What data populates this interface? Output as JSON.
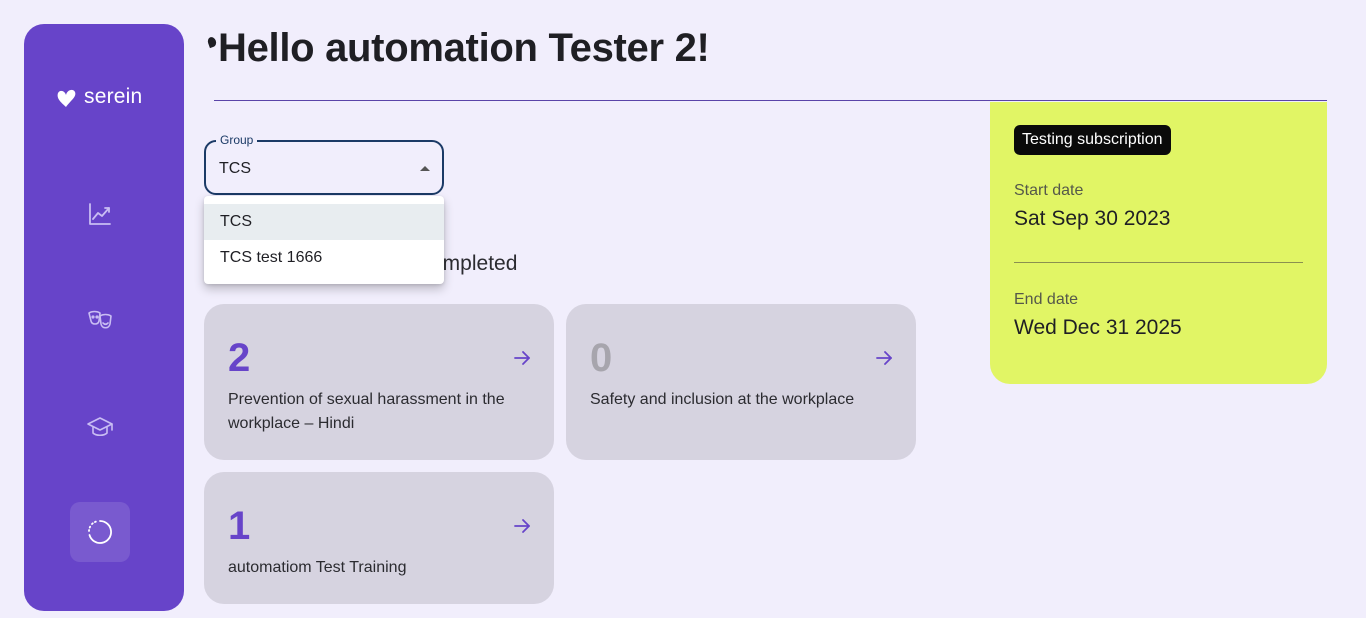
{
  "brand": {
    "name": "serein"
  },
  "sidebar": {
    "items": [
      {
        "icon": "chart-line-icon"
      },
      {
        "icon": "theater-masks-icon"
      },
      {
        "icon": "graduation-cap-icon"
      },
      {
        "icon": "progress-circle-icon",
        "active": true
      }
    ]
  },
  "header": {
    "greeting": "Hello automation Tester 2!"
  },
  "group_select": {
    "label": "Group",
    "value": "TCS",
    "options": [
      "TCS",
      "TCS test 1666"
    ]
  },
  "section": {
    "title_visible": "ompleted"
  },
  "courses": [
    {
      "count": "2",
      "title": "Prevention of sexual harassment in the workplace – Hindi"
    },
    {
      "count": "0",
      "title": "Safety and inclusion at the workplace"
    },
    {
      "count": "1",
      "title": "automatiom Test Training"
    }
  ],
  "subscription": {
    "name": "Testing subscription",
    "start_label": "Start date",
    "start_value": "Sat Sep 30 2023",
    "end_label": "End date",
    "end_value": "Wed Dec 31 2025"
  },
  "colors": {
    "sidebar": "#6744c9",
    "background": "#f1eefc",
    "subscription_panel": "#e1f565",
    "card": "#d6d3e0",
    "accent": "#6744c9"
  }
}
